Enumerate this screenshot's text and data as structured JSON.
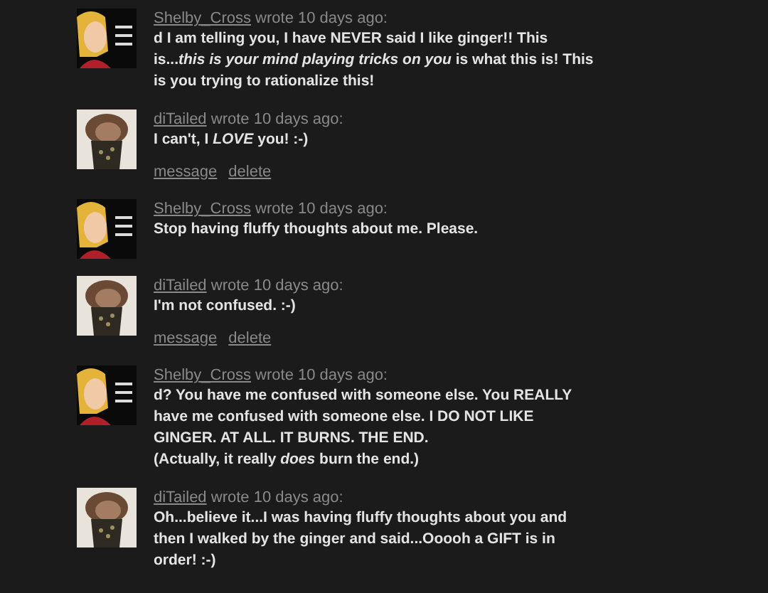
{
  "comments": [
    {
      "author": "Shelby_Cross",
      "meta": "wrote 10 days ago:",
      "avatar": {
        "kind": "cartoon"
      },
      "body": "d I am telling you, I have NEVER said I like ginger!! This is...*this is your mind playing tricks on you* is what this is! This is you trying to rationalize this!"
    },
    {
      "author": "diTailed",
      "meta": "wrote 10 days ago:",
      "avatar": {
        "kind": "photo"
      },
      "body": "I can't, I *LOVE* you! :-)",
      "actions": [
        "message",
        "delete"
      ]
    },
    {
      "author": "Shelby_Cross",
      "meta": "wrote 10 days ago:",
      "avatar": {
        "kind": "cartoon"
      },
      "body": "Stop having fluffy thoughts about me. Please."
    },
    {
      "author": "diTailed",
      "meta": "wrote 10 days ago:",
      "avatar": {
        "kind": "photo"
      },
      "body": "I'm not confused. :-)",
      "actions": [
        "message",
        "delete"
      ]
    },
    {
      "author": "Shelby_Cross",
      "meta": "wrote 10 days ago:",
      "avatar": {
        "kind": "cartoon"
      },
      "body": "d? You have me confused with someone else. You REALLY have me confused with someone else. I DO NOT LIKE GINGER. AT ALL. IT BURNS. THE END.\n(Actually, it really *does* burn the end.)"
    },
    {
      "author": "diTailed",
      "meta": "wrote 10 days ago:",
      "avatar": {
        "kind": "photo"
      },
      "body": "Oh...believe it...I was having fluffy thoughts about you and then I walked by the ginger and said...Ooooh a GIFT is in order! :-)"
    }
  ]
}
